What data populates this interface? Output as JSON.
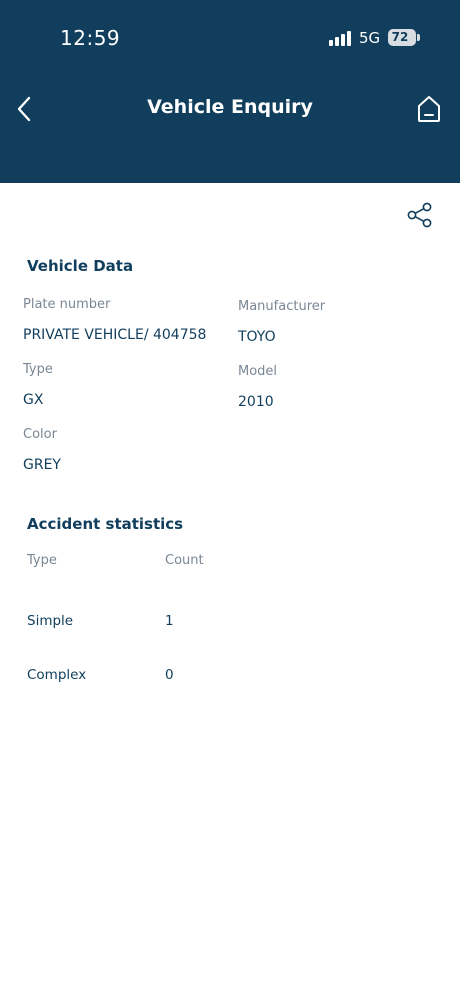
{
  "status_bar": {
    "time": "12:59",
    "network": "5G",
    "battery": "72",
    "icons": [
      "signal-bars-icon",
      "battery-icon"
    ]
  },
  "header": {
    "title": "Vehicle Enquiry",
    "background": "#103e5c",
    "icons": [
      "back-arrow-icon",
      "home-icon"
    ]
  },
  "toolbar": {
    "icons": [
      "share-icon"
    ]
  },
  "vehicle_data": {
    "title": "Vehicle Data",
    "fields": {
      "plate_number": {
        "label": "Plate number",
        "value": "PRIVATE VEHICLE/ 404758"
      },
      "manufacturer": {
        "label": "Manufacturer",
        "value": "TOYO"
      },
      "type": {
        "label": "Type",
        "value": "GX"
      },
      "model": {
        "label": "Model",
        "value": "2010"
      },
      "color": {
        "label": "Color",
        "value": "GREY"
      }
    }
  },
  "accident_statistics": {
    "title": "Accident statistics",
    "columns": [
      "Type",
      "Count"
    ],
    "rows": [
      {
        "type": "Simple",
        "count": "1"
      },
      {
        "type": "Complex",
        "count": "0"
      }
    ]
  }
}
